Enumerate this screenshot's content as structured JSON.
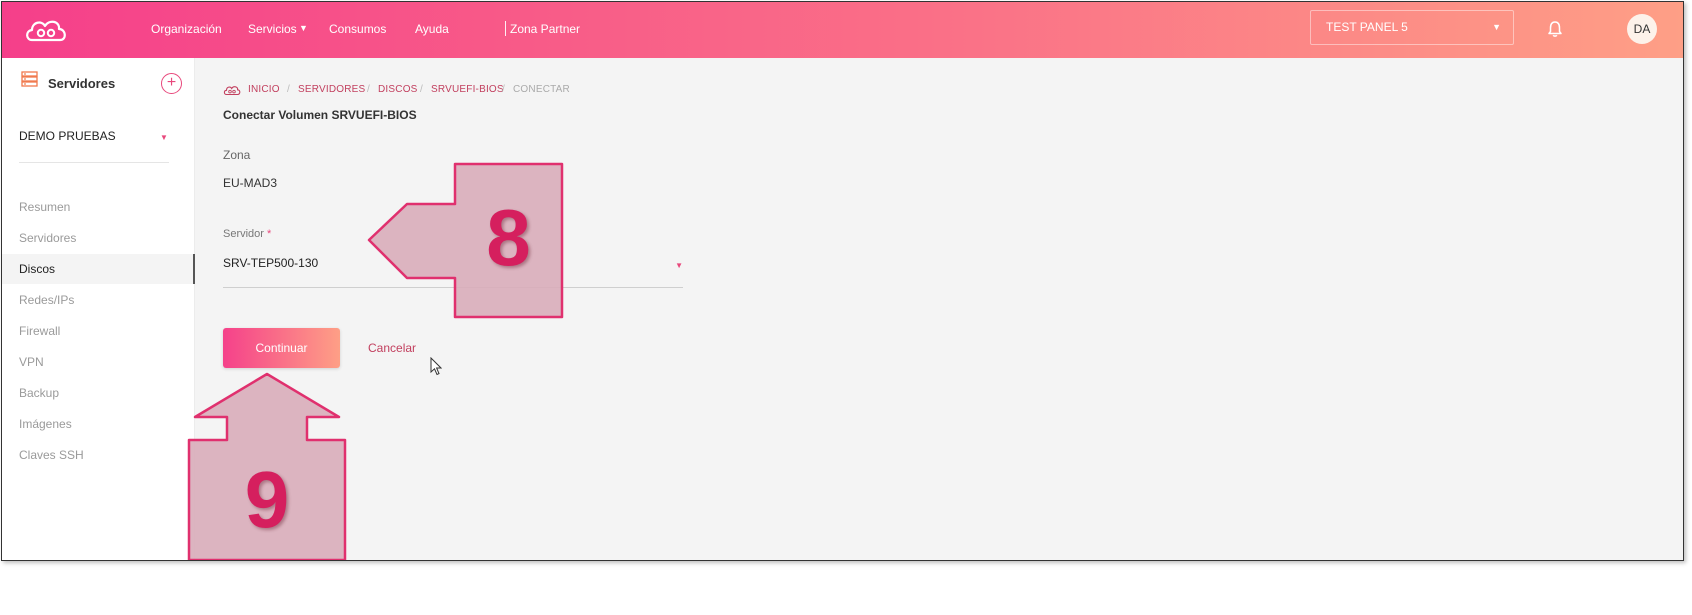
{
  "topbar": {
    "nav": [
      {
        "label": "Organización"
      },
      {
        "label": "Servicios"
      },
      {
        "label": "Consumos"
      },
      {
        "label": "Ayuda"
      },
      {
        "label": "Zona Partner"
      }
    ],
    "panel_select": "TEST PANEL 5",
    "avatar_initials": "DA"
  },
  "sidebar": {
    "title": "Servidores",
    "add_label": "+",
    "org_select": "DEMO PRUEBAS",
    "items": [
      {
        "label": "Resumen"
      },
      {
        "label": "Servidores"
      },
      {
        "label": "Discos",
        "active": true
      },
      {
        "label": "Redes/IPs"
      },
      {
        "label": "Firewall"
      },
      {
        "label": "VPN"
      },
      {
        "label": "Backup"
      },
      {
        "label": "Imágenes"
      },
      {
        "label": "Claves SSH"
      }
    ]
  },
  "breadcrumb": [
    "INICIO",
    "SERVIDORES",
    "DISCOS",
    "SRVUEFI-BIOS",
    "CONECTAR"
  ],
  "breadcrumb_sep": "/",
  "page_title": "Conectar Volumen SRVUEFI-BIOS",
  "form": {
    "zona_label": "Zona",
    "zona_value": "EU-MAD3",
    "server_label": "Servidor",
    "server_required": "*",
    "server_value": "SRV-TEP500-130",
    "continue_label": "Continuar",
    "cancel_label": "Cancelar"
  },
  "annotations": {
    "step_8": "8",
    "step_9": "9"
  },
  "colors": {
    "gradient_start": "#f53f8a",
    "gradient_end": "#fe9f86",
    "accent": "#c2405f",
    "callout_fill": "#d9aebb",
    "callout_stroke": "#e0306e"
  },
  "icons": {
    "logo": "cloud-icon",
    "servers": "server-stack-icon",
    "bell": "bell-icon",
    "cursor": "mouse-pointer-icon"
  }
}
